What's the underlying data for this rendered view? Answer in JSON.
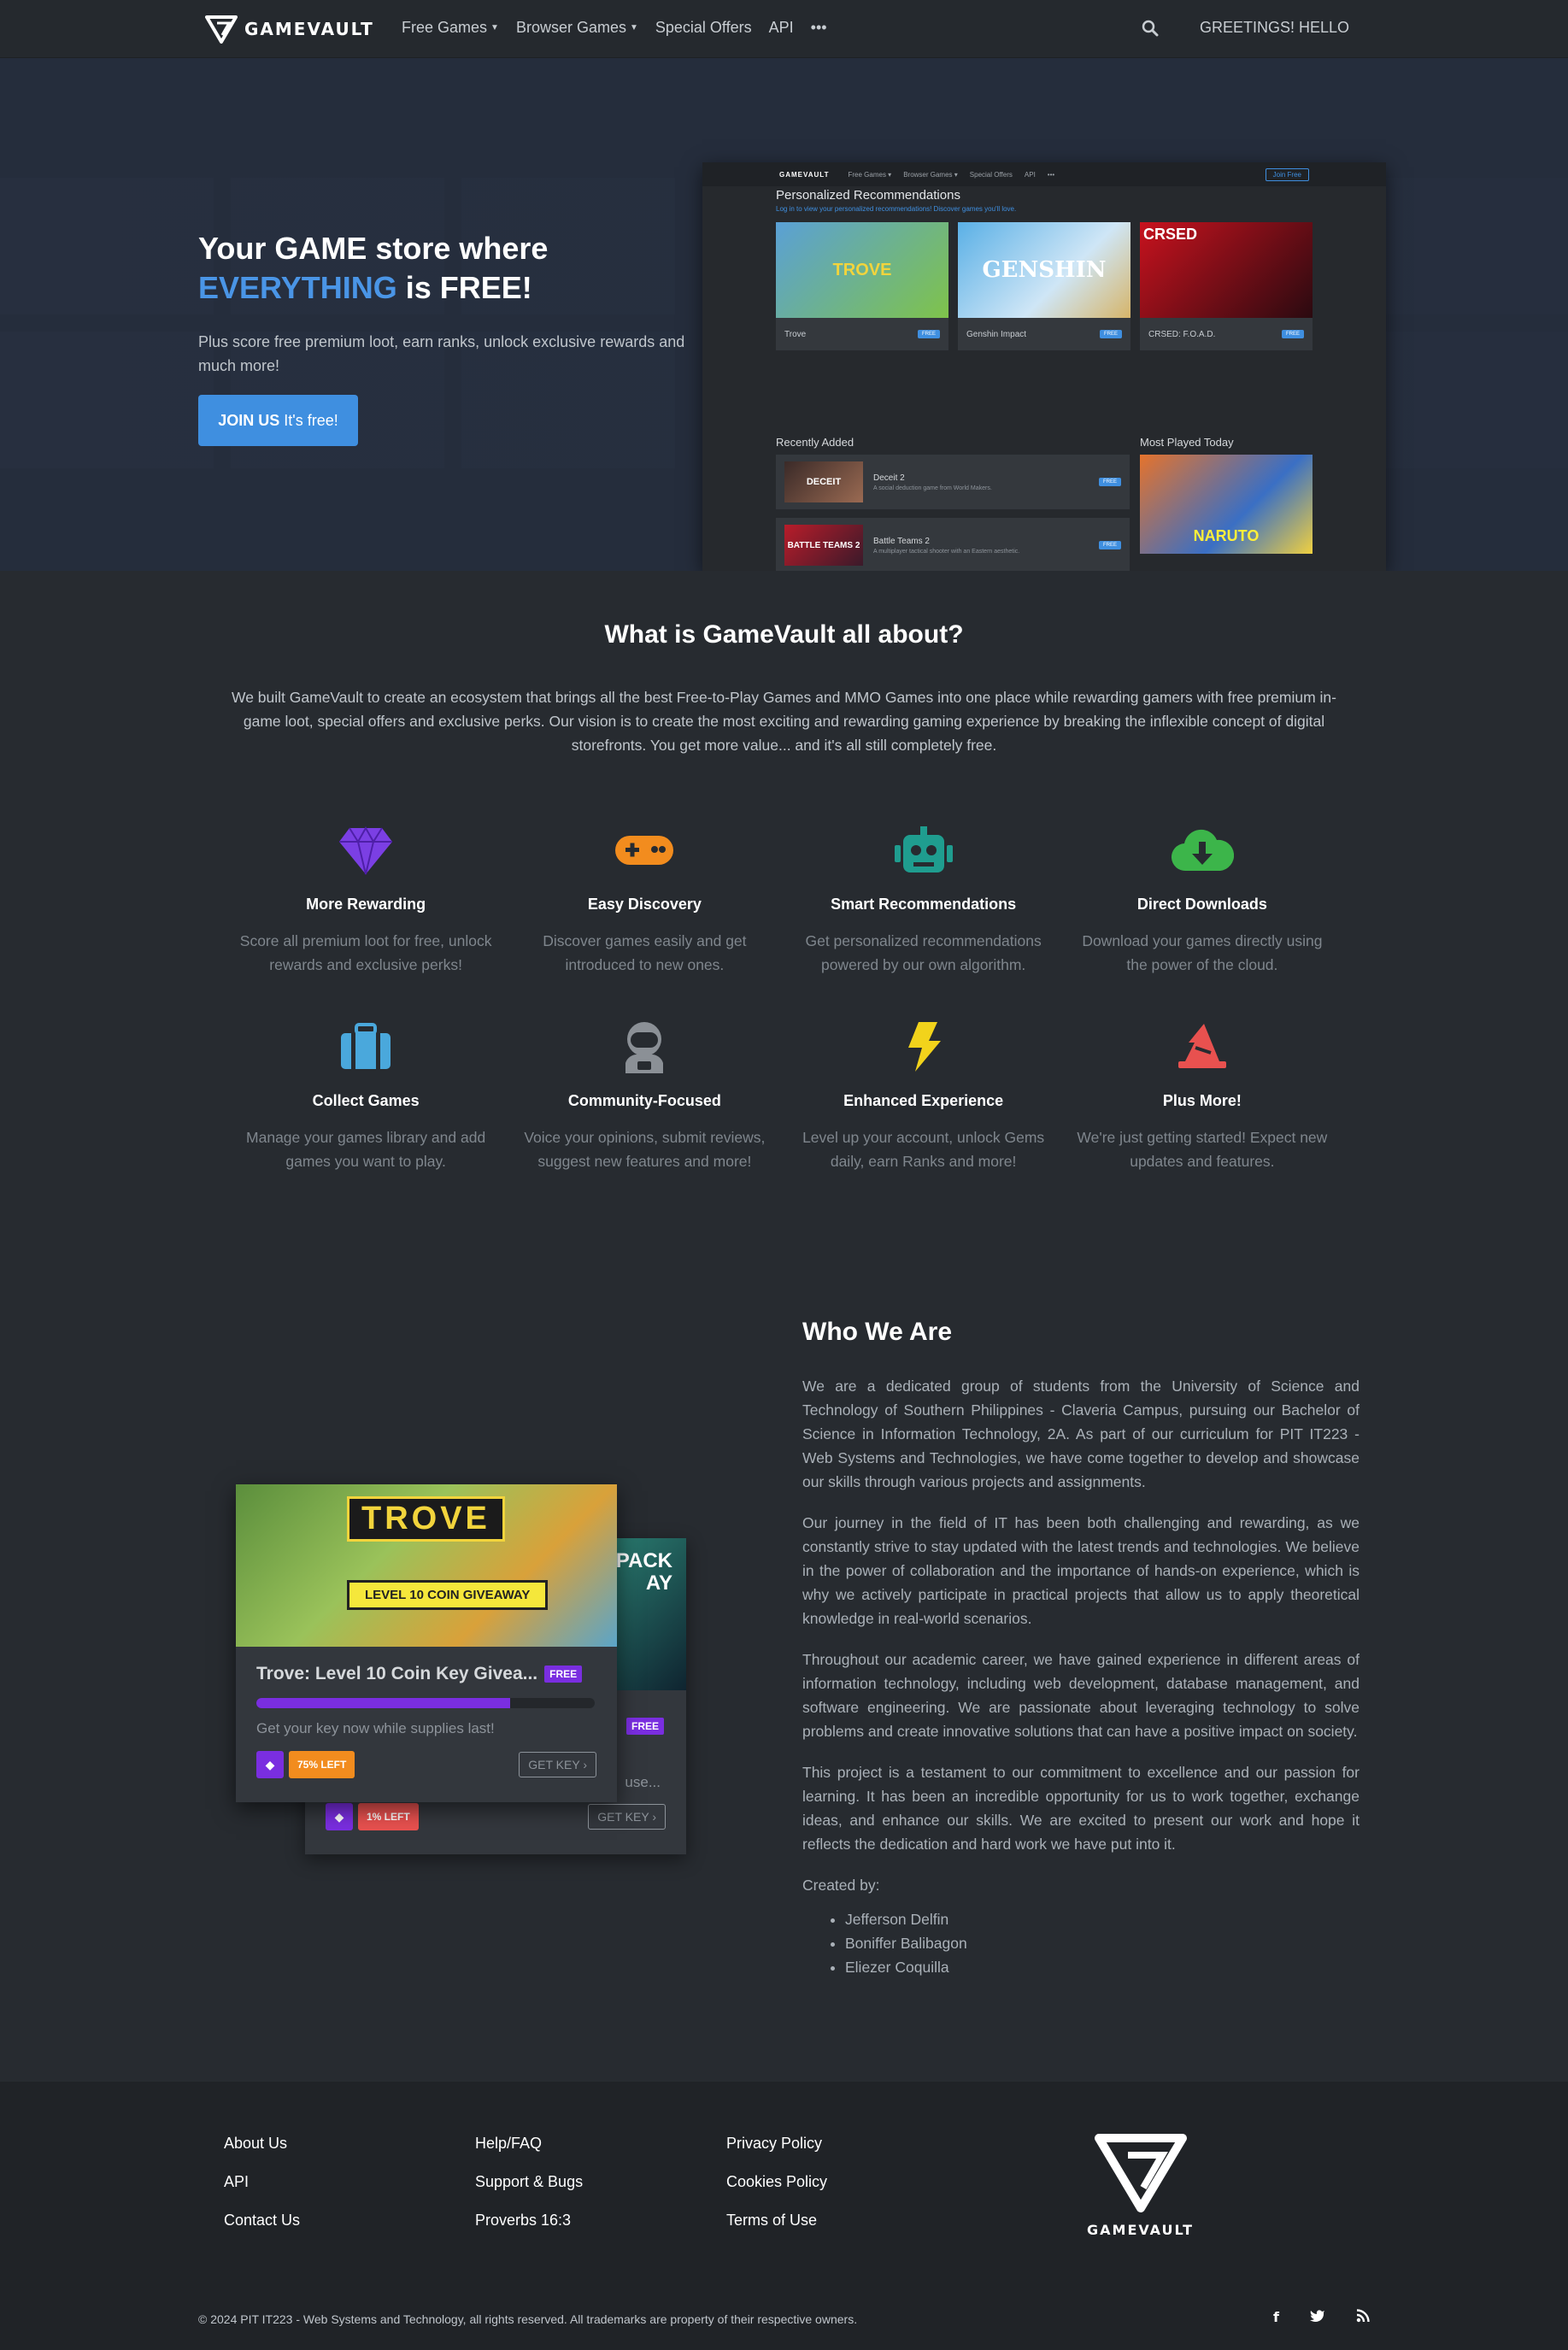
{
  "nav": {
    "brand": "GAMEVAULT",
    "links": [
      "Free Games",
      "Browser Games",
      "Special Offers",
      "API"
    ],
    "more": "•••",
    "greeting": "GREETINGS! HELLO"
  },
  "hero": {
    "title_line1": "Your GAME store where",
    "title_accent": "EVERYTHING",
    "title_tail": " is FREE!",
    "subtitle": "Plus score free premium loot, earn ranks, unlock exclusive rewards and much more!",
    "cta_bold": "JOIN US",
    "cta_rest": "It's free!",
    "preview": {
      "brand": "GAMEVAULT",
      "nav": [
        "Free Games ▾",
        "Browser Games ▾",
        "Special Offers",
        "API",
        "•••"
      ],
      "login": "Log in",
      "join": "Join Free",
      "heading": "Personalized Recommendations",
      "note": "Log in to view your personalized recommendations! Discover games you'll love.",
      "cards": [
        {
          "name": "Trove",
          "art": "TROVE"
        },
        {
          "name": "Genshin Impact",
          "art": "GENSHIN"
        },
        {
          "name": "CRSED: F.O.A.D.",
          "art": "CRSED"
        }
      ],
      "free_badge": "FREE",
      "recent_label": "Recently Added",
      "most_label": "Most Played Today",
      "recent": [
        {
          "name": "Deceit 2",
          "desc": "A social deduction game from World Makers.",
          "art": "DECEIT"
        },
        {
          "name": "Battle Teams 2",
          "desc": "A multiplayer tactical shooter with an Eastern aesthetic.",
          "art": "BATTLE TEAMS 2"
        }
      ],
      "most_art": "NARUTO"
    }
  },
  "about": {
    "title": "What is GameVault all about?",
    "text": "We built GameVault to create an ecosystem that brings all the best Free-to-Play Games and MMO Games into one place while rewarding gamers with free premium in-game loot, special offers and exclusive perks. Our vision is to create the most exciting and rewarding gaming experience by breaking the inflexible concept of digital storefronts. You get more value... and it's all still completely free."
  },
  "features": [
    {
      "icon": "gem-icon",
      "color": "#7b3fe4",
      "title": "More Rewarding",
      "desc": "Score all premium loot for free, unlock rewards and exclusive perks!"
    },
    {
      "icon": "gamepad-icon",
      "color": "#f28c1e",
      "title": "Easy Discovery",
      "desc": "Discover games easily and get introduced to new ones."
    },
    {
      "icon": "robot-icon",
      "color": "#1f9d8f",
      "title": "Smart Recommendations",
      "desc": "Get personalized recommendations powered by our own algorithm."
    },
    {
      "icon": "cloud-download-icon",
      "color": "#3cb54a",
      "title": "Direct Downloads",
      "desc": "Download your games directly using the power of the cloud."
    },
    {
      "icon": "suitcase-icon",
      "color": "#4aa8dc",
      "title": "Collect Games",
      "desc": "Manage your games library and add games you want to play."
    },
    {
      "icon": "user-astronaut-icon",
      "color": "#8b9096",
      "title": "Community-Focused",
      "desc": "Voice your opinions, submit reviews, suggest new features and more!"
    },
    {
      "icon": "bolt-icon",
      "color": "#f2d31b",
      "title": "Enhanced Experience",
      "desc": "Level up your account, unlock Gems daily, earn Ranks and more!"
    },
    {
      "icon": "wizard-hat-icon",
      "color": "#e8514f",
      "title": "Plus More!",
      "desc": "We're just getting started! Expect new updates and features."
    }
  ],
  "giveaway": {
    "front": {
      "art_logo": "TROVE",
      "art_sign": "LEVEL 10 COIN GIVEAWAY",
      "title": "Trove: Level 10 Coin Key Givea...",
      "badge": "FREE",
      "progress": 0.75,
      "subtitle": "Get your key now while supplies last!",
      "left": "75% LEFT",
      "button": "GET KEY ›"
    },
    "back": {
      "art_title": "PACK\nAY",
      "badge": "FREE",
      "subtitle": "use...",
      "left": "1% LEFT",
      "button": "GET KEY ›"
    }
  },
  "who": {
    "title": "Who We Are",
    "paragraphs": [
      "We are a dedicated group of students from the University of Science and Technology of Southern Philippines - Claveria Campus, pursuing our Bachelor of Science in Information Technology, 2A. As part of our curriculum for PIT IT223 - Web Systems and Technologies, we have come together to develop and showcase our skills through various projects and assignments.",
      "Our journey in the field of IT has been both challenging and rewarding, as we constantly strive to stay updated with the latest trends and technologies. We believe in the power of collaboration and the importance of hands-on experience, which is why we actively participate in practical projects that allow us to apply theoretical knowledge in real-world scenarios.",
      "Throughout our academic career, we have gained experience in different areas of information technology, including web development, database management, and software engineering. We are passionate about leveraging technology to solve problems and create innovative solutions that can have a positive impact on society.",
      "This project is a testament to our commitment to excellence and our passion for learning. It has been an incredible opportunity for us to work together, exchange ideas, and enhance our skills. We are excited to present our work and hope it reflects the dedication and hard work we have put into it."
    ],
    "created_by": "Created by:",
    "members": [
      "Jefferson Delfin",
      "Boniffer Balibagon",
      "Eliezer Coquilla"
    ]
  },
  "footer": {
    "col1": [
      "About Us",
      "API",
      "Contact Us"
    ],
    "col2": [
      "Help/FAQ",
      "Support & Bugs",
      "Proverbs 16:3"
    ],
    "col3": [
      "Privacy Policy",
      "Cookies Policy",
      "Terms of Use"
    ],
    "logo_text": "GAMEVAULT",
    "copyright": "© 2024 PIT IT223 - Web Systems and Technology, all rights reserved. All trademarks are property of their respective owners.",
    "social": [
      "facebook-icon",
      "twitter-icon",
      "rss-icon"
    ]
  }
}
